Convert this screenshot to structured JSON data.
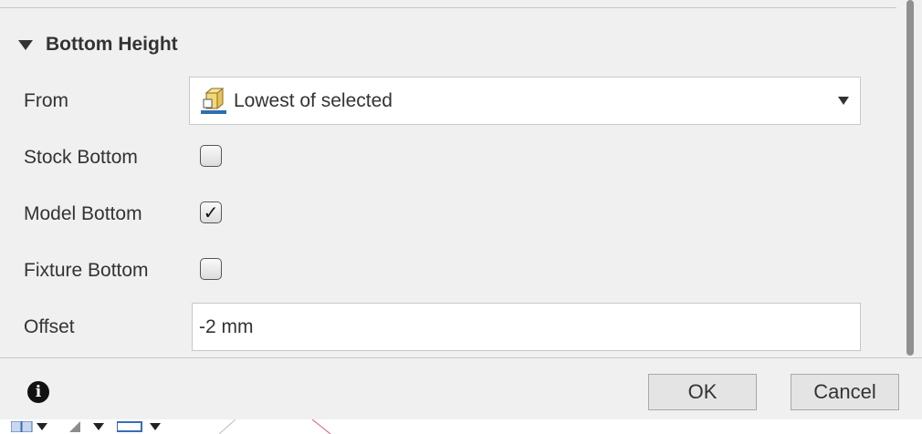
{
  "section": {
    "title": "Bottom Height",
    "expanded": true
  },
  "from": {
    "label": "From",
    "value": "Lowest of selected",
    "icon": "box-bottom-icon"
  },
  "stock_bottom": {
    "label": "Stock Bottom",
    "checked": false
  },
  "model_bottom": {
    "label": "Model Bottom",
    "checked": true,
    "check_glyph": "✓"
  },
  "fixture_bottom": {
    "label": "Fixture Bottom",
    "checked": false
  },
  "offset": {
    "label": "Offset",
    "value": "-2 mm"
  },
  "footer": {
    "info_glyph": "i",
    "ok_label": "OK",
    "cancel_label": "Cancel"
  },
  "colors": {
    "background": "#f0f0f0",
    "border": "#c8c8c8",
    "icon_box": "#e8c35a",
    "icon_base": "#2f6db0"
  }
}
